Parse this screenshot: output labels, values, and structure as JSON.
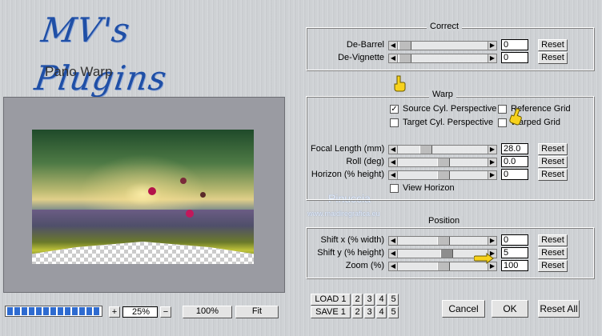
{
  "logo": {
    "text": "MV's Plugins"
  },
  "plugin_name": "Pano Warp",
  "groups": {
    "correct": "Correct",
    "warp": "Warp",
    "position": "Position"
  },
  "correct": {
    "rows": [
      {
        "label": "De-Barrel",
        "value": "0",
        "reset": "Reset"
      },
      {
        "label": "De-Vignette",
        "value": "0",
        "reset": "Reset"
      }
    ]
  },
  "warp": {
    "checkboxes": {
      "source_cyl": {
        "label": "Source Cyl. Perspective",
        "checked": true
      },
      "reference_grid": {
        "label": "Reference Grid",
        "checked": false
      },
      "target_cyl": {
        "label": "Target Cyl. Perspective",
        "checked": false
      },
      "warped_grid": {
        "label": "Warped Grid",
        "checked": false
      },
      "view_horizon": {
        "label": "View Horizon",
        "checked": false
      }
    },
    "rows": [
      {
        "label": "Focal Length (mm)",
        "value": "28.0",
        "reset": "Reset"
      },
      {
        "label": "Roll (deg)",
        "value": "0.0",
        "reset": "Reset"
      },
      {
        "label": "Horizon (% height)",
        "value": "0",
        "reset": "Reset"
      }
    ]
  },
  "position": {
    "rows": [
      {
        "label": "Shift x (% width)",
        "value": "0",
        "reset": "Reset"
      },
      {
        "label": "Shift y (% height)",
        "value": "5",
        "reset": "Reset"
      },
      {
        "label": "Zoom (%)",
        "value": "100",
        "reset": "Reset"
      }
    ]
  },
  "watermark": {
    "line1": "Pinuccia",
    "line2": "www.maidiregrafica.eu"
  },
  "zoom": {
    "plus": "+",
    "value": "25%",
    "minus": "−",
    "hundred": "100%",
    "fit": "Fit"
  },
  "presets": {
    "load": "LOAD 1",
    "save": "SAVE 1",
    "slots": [
      "2",
      "3",
      "4",
      "5"
    ]
  },
  "actions": {
    "cancel": "Cancel",
    "ok": "OK",
    "reset_all": "Reset All"
  },
  "colors": {
    "accent_blue": "#2e6bd0",
    "pointer_yellow": "#f7d21c"
  },
  "icons": {
    "pointer": "hand-pointer-icon",
    "check": "check-icon"
  }
}
